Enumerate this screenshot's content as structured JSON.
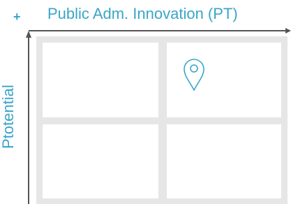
{
  "diagram": {
    "plus_sign": "+",
    "x_axis_label": "Public Adm. Innovation (PT)",
    "y_axis_label": "Ptotential",
    "grid": {
      "rows": 2,
      "columns": 2
    },
    "marker": {
      "icon": "location-pin-icon",
      "quadrant": "top-right"
    },
    "colors": {
      "accent": "#3aa6c8",
      "axis": "#555555",
      "grid_line": "#e6e6e6"
    }
  }
}
